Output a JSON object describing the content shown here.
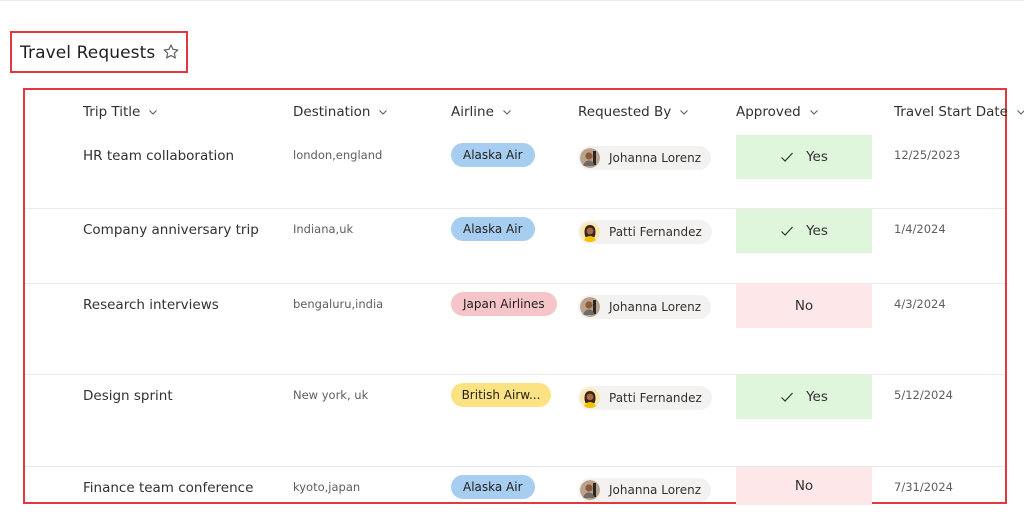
{
  "list": {
    "title": "Travel Requests"
  },
  "columns": [
    {
      "key": "title",
      "label": "Trip Title"
    },
    {
      "key": "destination",
      "label": "Destination"
    },
    {
      "key": "airline",
      "label": "Airline"
    },
    {
      "key": "requested_by",
      "label": "Requested By"
    },
    {
      "key": "approved",
      "label": "Approved"
    },
    {
      "key": "start_date",
      "label": "Travel Start Date"
    }
  ],
  "airline_colors": {
    "Alaska Air": "#a7cdf0",
    "Japan Airlines": "#f6c5c9",
    "British Airw...": "#fbe283"
  },
  "approved_colors": {
    "Yes": "#dff6dd",
    "No": "#fde7e9"
  },
  "rows": [
    {
      "title": "HR team collaboration",
      "destination": "london,england",
      "airline": "Alaska Air",
      "requested_by": "Johanna Lorenz",
      "approved": "Yes",
      "start_date": "12/25/2023"
    },
    {
      "title": "Company anniversary trip",
      "destination": "Indiana,uk",
      "airline": "Alaska Air",
      "requested_by": "Patti Fernandez",
      "approved": "Yes",
      "start_date": "1/4/2024"
    },
    {
      "title": "Research interviews",
      "destination": "bengaluru,india",
      "airline": "Japan Airlines",
      "requested_by": "Johanna Lorenz",
      "approved": "No",
      "start_date": "4/3/2024"
    },
    {
      "title": "Design sprint",
      "destination": "New york, uk",
      "airline": "British Airw...",
      "requested_by": "Patti Fernandez",
      "approved": "Yes",
      "start_date": "5/12/2024"
    },
    {
      "title": "Finance team conference",
      "destination": "kyoto,japan",
      "airline": "Alaska Air",
      "requested_by": "Johanna Lorenz",
      "approved": "No",
      "start_date": "7/31/2024"
    }
  ]
}
